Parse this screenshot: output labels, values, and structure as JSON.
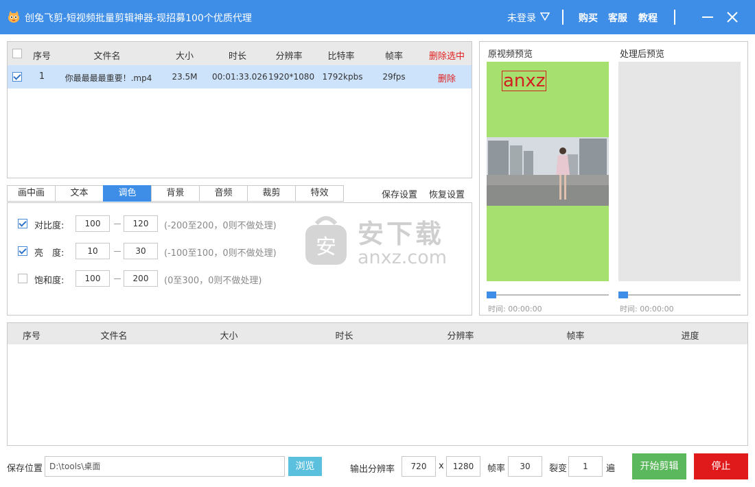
{
  "titlebar": {
    "title": "创兔飞剪-短视频批量剪辑神器-现招募100个优质代理",
    "login": "未登录",
    "nav": [
      "购买",
      "客服",
      "教程"
    ]
  },
  "source_table": {
    "headers": [
      "序号",
      "文件名",
      "大小",
      "时长",
      "分辨率",
      "比特率",
      "帧率"
    ],
    "delete_selected": "删除选中",
    "rows": [
      {
        "checked": true,
        "index": "1",
        "filename": "你最最最最重要！.mp4",
        "size": "23.5M",
        "duration": "00:01:33.026",
        "resolution": "1920*1080",
        "bitrate": "1792kpbs",
        "fps": "29fps",
        "delete": "删除"
      }
    ]
  },
  "tabs": [
    "画中画",
    "文本",
    "调色",
    "背景",
    "音频",
    "裁剪",
    "特效"
  ],
  "active_tab": "调色",
  "tab_actions": {
    "save": "保存设置",
    "restore": "恢复设置"
  },
  "color_settings": [
    {
      "checked": true,
      "label": "对比度:",
      "min": "100",
      "max": "120",
      "hint": "(-200至200，0则不做处理)"
    },
    {
      "checked": true,
      "label": "亮　度:",
      "min": "10",
      "max": "30",
      "hint": "(-100至100，0则不做处理)"
    },
    {
      "checked": false,
      "label": "饱和度:",
      "min": "100",
      "max": "200",
      "hint": "(0至300，0则不做处理)"
    }
  ],
  "preview": {
    "original_title": "原视频预览",
    "processed_title": "处理后预览",
    "overlay_text": "anxz",
    "original_time": "时间: 00:00:00",
    "processed_time": "时间: 00:00:00"
  },
  "watermark": {
    "cn": "安下载",
    "en": "anxz.com",
    "glyph": "安"
  },
  "output_table": {
    "headers": [
      "序号",
      "文件名",
      "大小",
      "时长",
      "分辨率",
      "帧率",
      "进度"
    ]
  },
  "bottom": {
    "save_location_label": "保存位置",
    "save_path": "D:\\tools\\桌面",
    "browse": "浏览",
    "output_res_label": "输出分辨率",
    "width": "720",
    "x": "x",
    "height": "1280",
    "fps_label": "帧率",
    "fps": "30",
    "fission_label": "裂变",
    "fission": "1",
    "times_unit": "遍",
    "start": "开始剪辑",
    "stop": "停止"
  },
  "colors": {
    "titlebar": "#3e8ee8",
    "active_tab": "#3e8ee8",
    "delete_red": "#e02020",
    "preview_green": "#a6e06f",
    "start_green": "#5cb85c",
    "stop_red": "#e01a1a",
    "browse_blue": "#5bc0de"
  }
}
